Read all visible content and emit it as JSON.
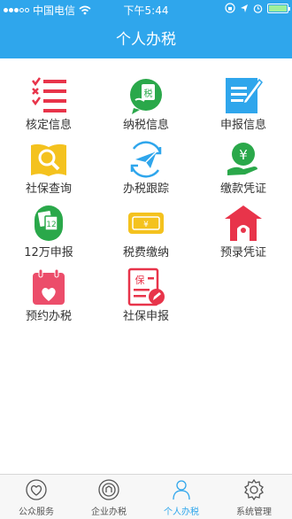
{
  "status_bar": {
    "carrier": "中国电信",
    "time": "下午5:44"
  },
  "header": {
    "title": "个人办税"
  },
  "grid": {
    "items": [
      {
        "label": "核定信息",
        "icon": "checklist-icon"
      },
      {
        "label": "纳税信息",
        "icon": "tax-chat-icon"
      },
      {
        "label": "申报信息",
        "icon": "edit-document-icon"
      },
      {
        "label": "社保查询",
        "icon": "book-search-icon"
      },
      {
        "label": "办税跟踪",
        "icon": "paper-plane-icon"
      },
      {
        "label": "缴款凭证",
        "icon": "yuan-hand-icon"
      },
      {
        "label": "12万申报",
        "icon": "money-12-icon"
      },
      {
        "label": "税费缴纳",
        "icon": "banknote-icon"
      },
      {
        "label": "预录凭证",
        "icon": "house-icon"
      },
      {
        "label": "预约办税",
        "icon": "calendar-heart-icon"
      },
      {
        "label": "社保申报",
        "icon": "social-insurance-icon"
      }
    ]
  },
  "tabbar": {
    "tabs": [
      {
        "label": "公众服务",
        "icon": "heart-icon",
        "active": false
      },
      {
        "label": "企业办税",
        "icon": "building-icon",
        "active": false
      },
      {
        "label": "个人办税",
        "icon": "person-icon",
        "active": true
      },
      {
        "label": "系统管理",
        "icon": "gear-icon",
        "active": false
      }
    ]
  },
  "colors": {
    "header": "#2fa6ec",
    "active_tab": "#2fa6ec"
  }
}
